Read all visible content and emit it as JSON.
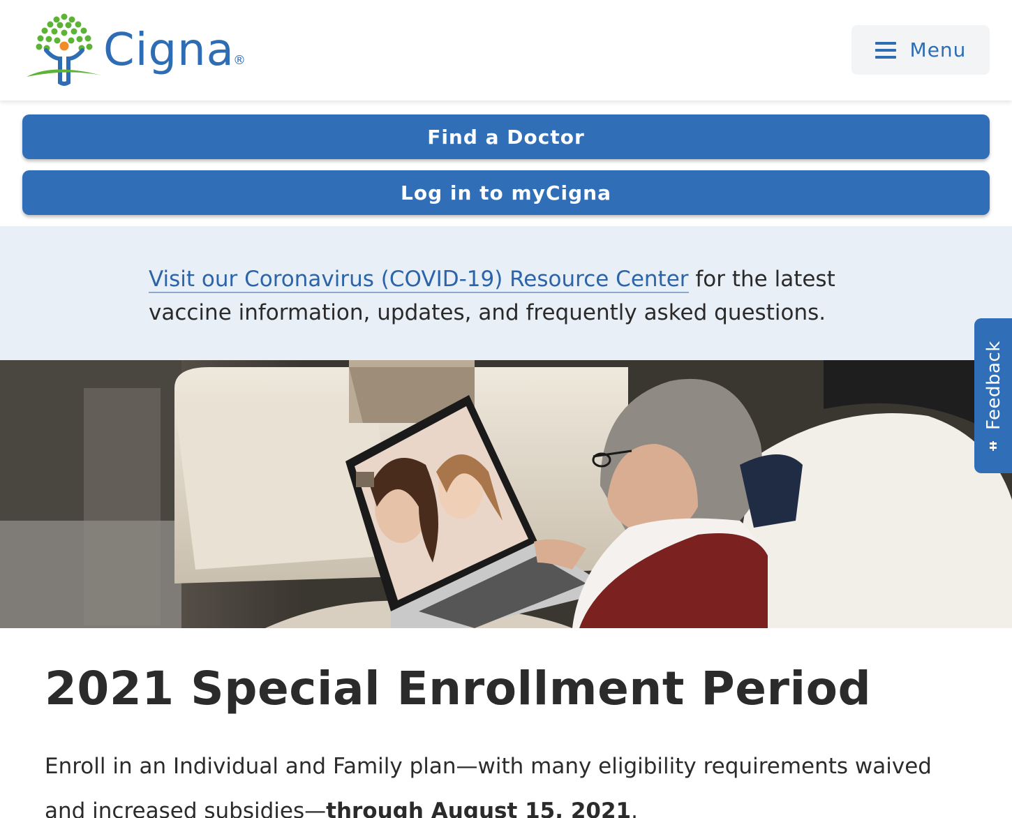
{
  "header": {
    "brand_name": "Cigna",
    "brand_mark": "®",
    "menu_label": "Menu",
    "brand_color": "#2e6db4"
  },
  "cta": {
    "find_doctor_label": "Find a Doctor",
    "login_label": "Log in to myCigna",
    "button_color": "#306fb8"
  },
  "banner": {
    "link_text": "Visit our Coronavirus (COVID-19) Resource Center",
    "text_after": " for the latest vaccine information, updates, and frequently asked questions.",
    "background": "#e8eff7"
  },
  "feedback": {
    "label": "Feedback",
    "icon": "feedback-icon"
  },
  "hero": {
    "icon": "hero-photo"
  },
  "main": {
    "title": "2021 Special Enrollment Period",
    "intro_text": "Enroll in an Individual and Family plan—with many eligibility requirements waived and increased subsidies—",
    "intro_bold": "through August 15, 2021",
    "intro_end": "."
  }
}
